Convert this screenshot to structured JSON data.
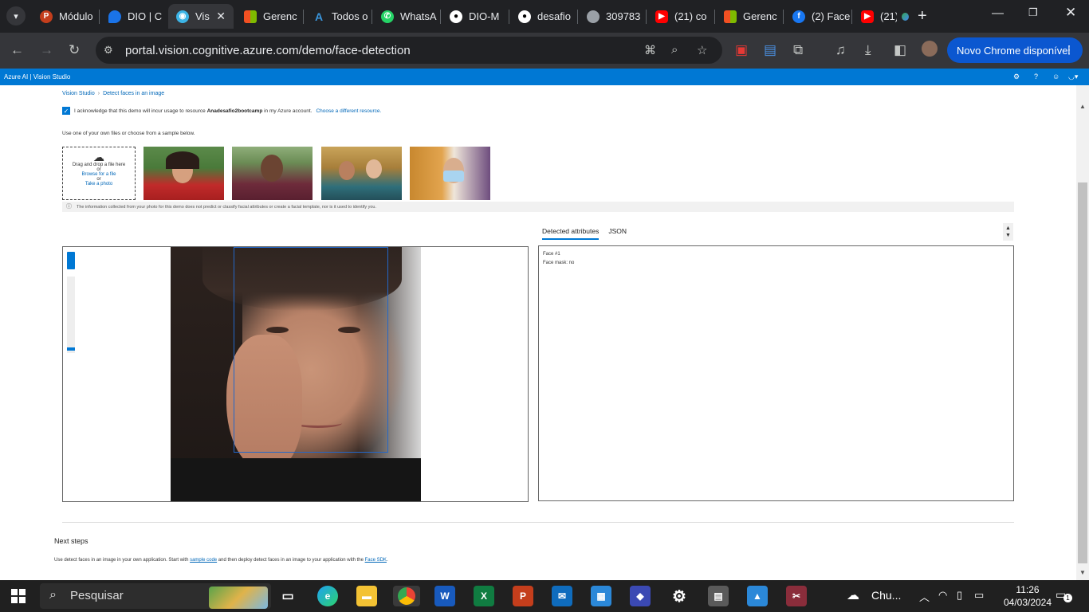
{
  "browser": {
    "tabs": [
      {
        "title": "Módulo",
        "icon": "powerpoint-icon",
        "color": "#c43e1c"
      },
      {
        "title": "DIO | C",
        "icon": "dio-icon",
        "color": "#1a73e8"
      },
      {
        "title": "Vis",
        "icon": "vision-studio-icon",
        "color": "#3cb4e6",
        "active": true
      },
      {
        "title": "Gerenc",
        "icon": "microsoft-icon",
        "color": "#f25022"
      },
      {
        "title": "Todos o",
        "icon": "azure-icon",
        "color": "#0078d4"
      },
      {
        "title": "WhatsA",
        "icon": "whatsapp-icon",
        "color": "#25d366"
      },
      {
        "title": "DIO-M",
        "icon": "github-icon",
        "color": "#ffffff"
      },
      {
        "title": "desafio",
        "icon": "github-icon",
        "color": "#ffffff"
      },
      {
        "title": "309783",
        "icon": "globe-icon",
        "color": "#9aa0a6"
      },
      {
        "title": "(21) co",
        "icon": "youtube-icon",
        "color": "#ff0000"
      },
      {
        "title": "Gerenc",
        "icon": "microsoft-icon",
        "color": "#f25022"
      },
      {
        "title": "(2) Face",
        "icon": "facebook-icon",
        "color": "#1877f2"
      },
      {
        "title": "(21)",
        "icon": "youtube-icon",
        "color": "#ff0000"
      }
    ],
    "url": "portal.vision.cognitive.azure.com/demo/face-detection",
    "update_chip": "Novo Chrome disponível"
  },
  "azure_header": {
    "brand": "Azure AI  |  Vision Studio"
  },
  "page": {
    "breadcrumb": [
      "Vision Studio",
      "Detect faces in an image"
    ],
    "ack": {
      "prefix": "I acknowledge that this demo will incur usage to resource",
      "resource": "Anadesafio2bootcamp",
      "suffix": "in my Azure account.",
      "link": "Choose a different resource."
    },
    "sample_hint": "Use one of your own files or choose from a sample below.",
    "upload": {
      "drag": "Drag and drop a file here",
      "or1": "or",
      "browse": "Browse for a file",
      "or2": "or",
      "photo": "Take a photo"
    },
    "info_text": "The information collected from your photo for this demo does not predict or classify facial attributes or create a facial template, nor is it used to identify you.",
    "result_tabs": [
      "Detected attributes",
      "JSON"
    ],
    "results": [
      "Face #1",
      "Face mask: no"
    ],
    "next_steps": {
      "title": "Next steps",
      "text_a": "Use detect faces in an image in your own application. Start with",
      "link_a": "sample code",
      "text_b": "and then deploy detect faces in an image to your application with the",
      "link_b": "Face SDK",
      "text_c": "."
    }
  },
  "taskbar": {
    "search": "Pesquisar",
    "weather": "Chu...",
    "time": "11:26",
    "date": "04/03/2024",
    "notifications": "1"
  }
}
